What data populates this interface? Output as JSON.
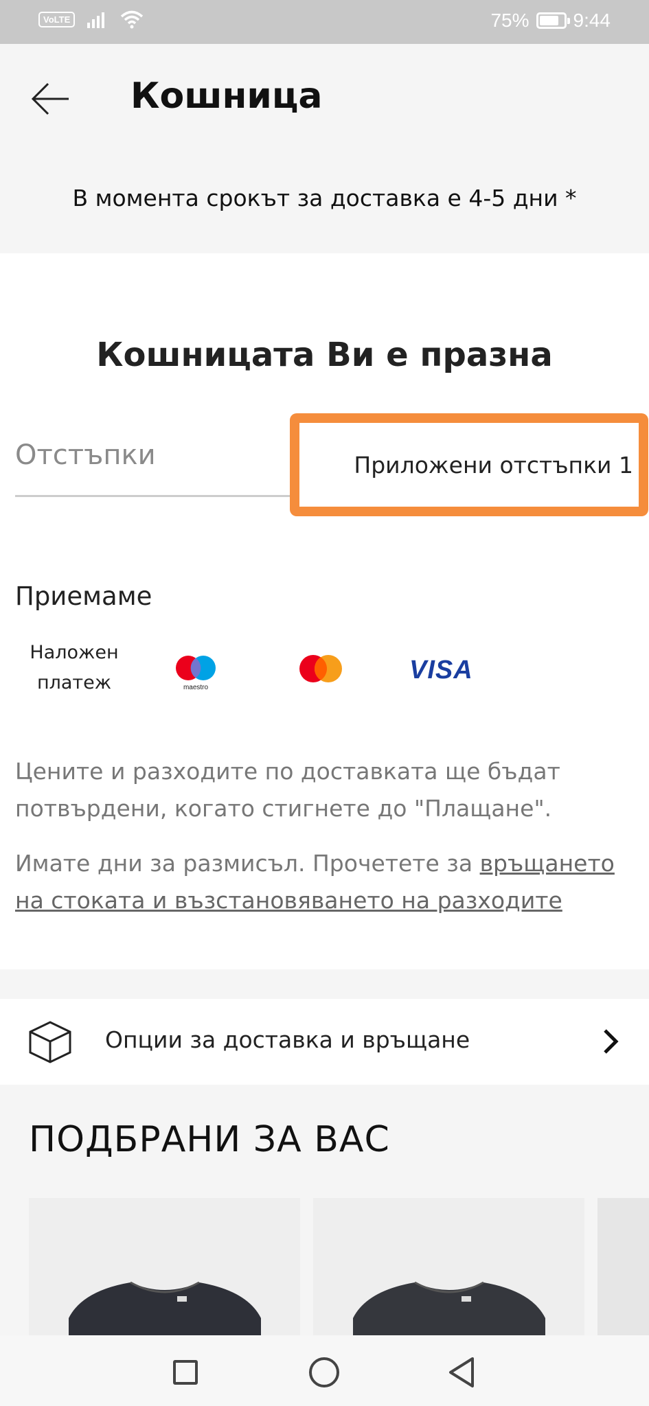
{
  "status_bar": {
    "network_label": "VoLTE",
    "battery_percent": "75%",
    "battery_level": 0.75,
    "time": "9:44",
    "icons": [
      "signal-icon",
      "wifi-icon",
      "battery-icon"
    ]
  },
  "header": {
    "back_icon": "arrow-left-icon",
    "title": "Кошница",
    "delivery_note": "В момента срокът за доставка е 4-5 дни *"
  },
  "cart": {
    "empty_title": "Кошницата Ви е празна",
    "tabs": {
      "discounts": "Отстъпки",
      "applied_discounts": "Приложени отстъпки 1"
    },
    "accept_title": "Приемаме",
    "payments": {
      "cod_line1": "Наложен",
      "cod_line2": "платеж",
      "maestro_label": "maestro",
      "visa_label": "VISA"
    },
    "info_prices": "Цените и разходите по доставката ще бъдат потвърдени, когато стигнете до \"Плащане\".",
    "info_returns_text": "Имате  дни за размисъл. Прочетете за ",
    "info_returns_link": "връщането на стоката и възстановяването на разходите"
  },
  "delivery_row": {
    "icon": "box-icon",
    "label": "Опции за доставка и връщане",
    "chevron": "chevron-right-icon"
  },
  "recommendations": {
    "title": "ПОДБРАНИ ЗА ВАС"
  },
  "colors": {
    "highlight": "#f58d3c",
    "visa_blue": "#1a3ea0",
    "mastercard_red": "#eb001b",
    "mastercard_orange": "#f79e1b",
    "maestro_blue": "#00a2e5"
  }
}
